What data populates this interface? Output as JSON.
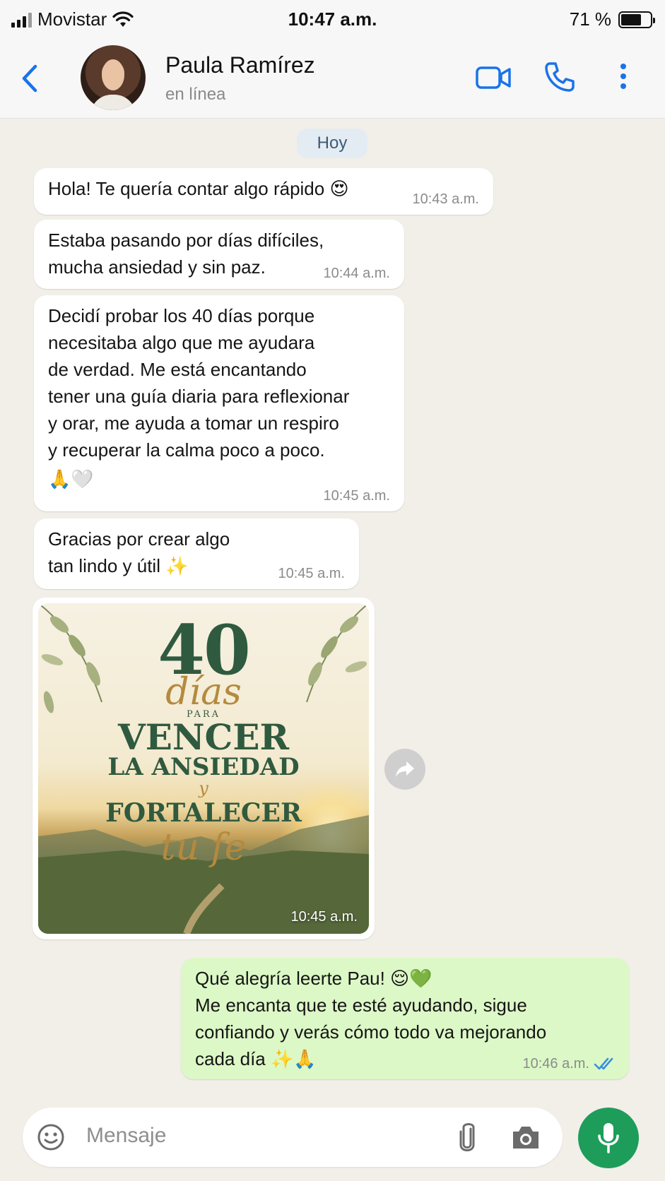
{
  "status_bar": {
    "carrier": "Movistar",
    "time": "10:47 a.m.",
    "battery": "71 %",
    "battery_level": 0.71
  },
  "header": {
    "contact_name": "Paula Ramírez",
    "contact_status": "en línea",
    "icons": [
      "back-icon",
      "video-call-icon",
      "phone-icon",
      "more-options-icon"
    ]
  },
  "chat": {
    "day_label": "Hoy",
    "messages": [
      {
        "direction": "in",
        "lines": [
          "Hola! Te quería contar algo rápido 😍"
        ],
        "time": "10:43 a.m."
      },
      {
        "direction": "in",
        "lines": [
          "Estaba pasando por días difíciles,",
          "mucha ansiedad y sin paz."
        ],
        "time": "10:44 a.m."
      },
      {
        "direction": "in",
        "lines": [
          "Decidí probar los 40 días porque",
          "necesitaba algo que me ayudara",
          "de verdad. Me está encantando",
          "tener una guía diaria para reflexionar",
          "y orar, me ayuda a tomar un respiro",
          "y recuperar la calma poco a poco.",
          "🙏🤍"
        ],
        "time": "10:45 a.m."
      },
      {
        "direction": "in",
        "lines": [
          "Gracias por crear algo",
          "tan lindo y útil ✨"
        ],
        "time": "10:45 a.m."
      },
      {
        "direction": "in",
        "type": "image",
        "time": "10:45 a.m.",
        "image_text": {
          "number": "40",
          "dias": "días",
          "para": "PARA",
          "vencer": "VENCER",
          "ansiedad": "LA ANSIEDAD",
          "y": "y",
          "fortalecer": "FORTALECER",
          "tufe": "tu fe"
        }
      },
      {
        "direction": "out",
        "lines": [
          "Qué alegría leerte Pau! 😌💚",
          "Me encanta que te esté ayudando, sigue",
          "confiando y verás cómo todo va mejorando",
          "cada día ✨🙏"
        ],
        "time": "10:46 a.m.",
        "read": true
      }
    ]
  },
  "input": {
    "placeholder": "Mensaje"
  },
  "colors": {
    "accent_blue": "#1a73e8",
    "outgoing_bubble": "#dcf8c6",
    "mic_green": "#1e9d5a",
    "chat_bg": "#f2efe9"
  }
}
